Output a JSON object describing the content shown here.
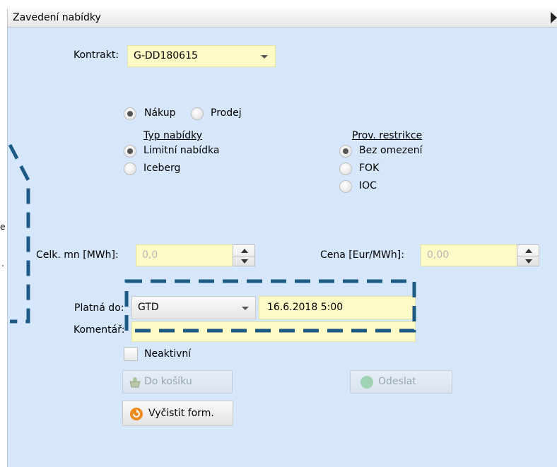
{
  "panel": {
    "title": "Zavedení nabídky"
  },
  "form": {
    "contract_label": "Kontrakt:",
    "contract_value": "G-DD180615",
    "side": {
      "buy": "Nákup",
      "sell": "Prodej",
      "selected": "Nákup"
    },
    "offer_type": {
      "heading": "Typ nabídky",
      "options": [
        "Limitní nabídka",
        "Iceberg"
      ],
      "selected": "Limitní nabídka"
    },
    "restriction": {
      "heading": "Prov. restrikce",
      "options": [
        "Bez omezení",
        "FOK",
        "IOC"
      ],
      "selected": "Bez omezení"
    },
    "quantity": {
      "label": "Celk. mn [MWh]:",
      "value": "0,0"
    },
    "price": {
      "label": "Cena [Eur/MWh]:",
      "value": "0,00"
    },
    "valid_until": {
      "label": "Platná do:",
      "mode": "GTD",
      "datetime": "16.6.2018 5:00"
    },
    "comment": {
      "label": "Komentář:",
      "value": ""
    },
    "inactive": {
      "label": "Neaktivní",
      "checked": false
    },
    "buttons": {
      "to_basket": "Do košíku",
      "send": "Odeslat",
      "clear": "Vyčistit form."
    }
  },
  "left_strip": {
    "fragment_1": "e",
    "fragment_2": "."
  },
  "colors": {
    "panel_bg": "#d6e7fb",
    "field_bg": "#fffbc7",
    "highlight_dash": "#1d5a86",
    "clear_icon": "#f08a1c",
    "send_icon": "#3fb871"
  }
}
